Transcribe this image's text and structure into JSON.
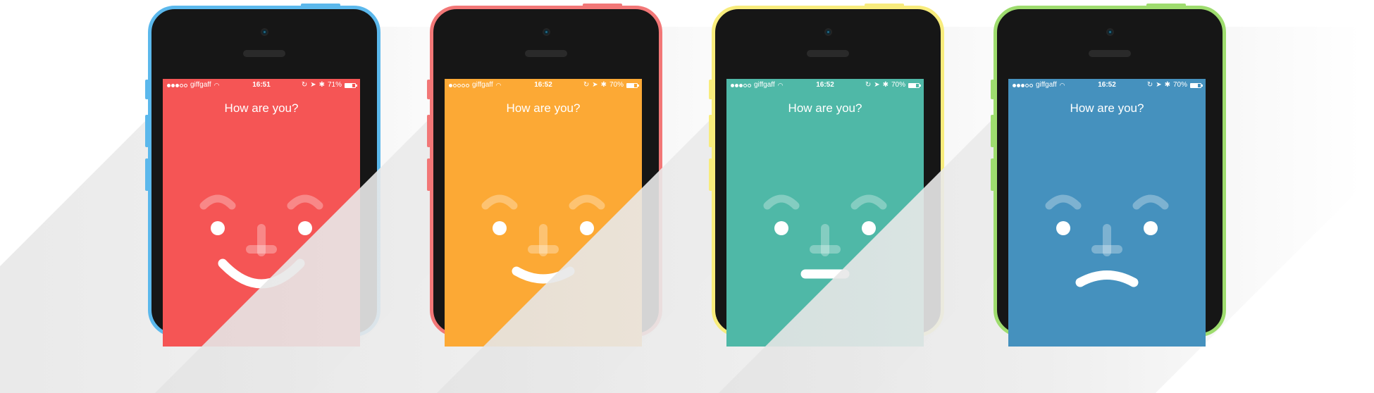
{
  "phones": [
    {
      "shell_color": "#5BB8EC",
      "screen_color": "#F55555",
      "status": {
        "carrier": "giffgaff",
        "time": "16:51",
        "battery": "71%",
        "battery_level": 0.71
      },
      "question": "How are you?",
      "mood": "happy"
    },
    {
      "shell_color": "#F27777",
      "screen_color": "#FCA935",
      "status": {
        "carrier": "giffgaff",
        "time": "16:52",
        "battery": "70%",
        "battery_level": 0.7
      },
      "question": "How are you?",
      "mood": "content"
    },
    {
      "shell_color": "#F8EC7C",
      "screen_color": "#4FB8A7",
      "status": {
        "carrier": "giffgaff",
        "time": "16:52",
        "battery": "70%",
        "battery_level": 0.7
      },
      "question": "How are you?",
      "mood": "neutral"
    },
    {
      "shell_color": "#9EDC6E",
      "screen_color": "#4591BE",
      "status": {
        "carrier": "giffgaff",
        "time": "16:52",
        "battery": "70%",
        "battery_level": 0.7
      },
      "question": "How are you?",
      "mood": "sad"
    }
  ],
  "icons": {
    "wifi": "wifi-icon",
    "lock": "rotation-lock-icon",
    "location": "location-arrow-icon",
    "bluetooth": "bluetooth-icon",
    "battery": "battery-icon"
  }
}
